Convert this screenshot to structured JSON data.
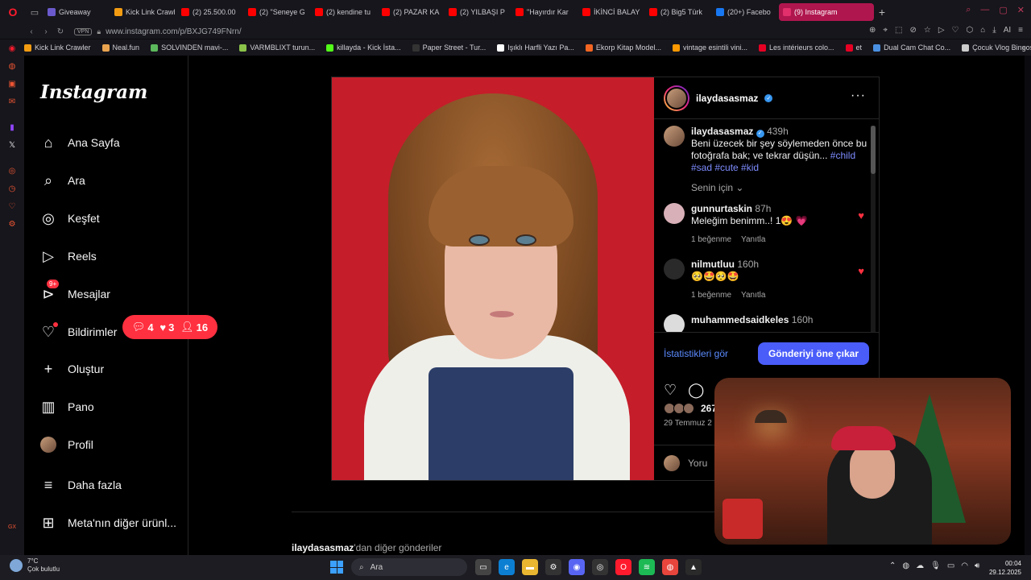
{
  "browser": {
    "tabs": [
      {
        "label": "Giveaway",
        "color": "#6a5acd"
      },
      {
        "label": "Kick Link Crawl",
        "color": "#f39c12"
      },
      {
        "label": "(2) 25.500.00",
        "color": "#ff0000"
      },
      {
        "label": "(2) \"Seneye G",
        "color": "#ff0000"
      },
      {
        "label": "(2) kendine tu",
        "color": "#ff0000"
      },
      {
        "label": "(2) PAZAR KA",
        "color": "#ff0000"
      },
      {
        "label": "(2) YILBAŞI P",
        "color": "#ff0000"
      },
      {
        "label": "\"Hayırdır Kar",
        "color": "#ff0000"
      },
      {
        "label": "İKİNCİ BALAY",
        "color": "#ff0000"
      },
      {
        "label": "(2) Big5 Türk",
        "color": "#ff0000"
      },
      {
        "label": "(20+) Facebo",
        "color": "#1877f2"
      },
      {
        "label": "(9) Instagram",
        "color": "#e1306c"
      }
    ],
    "active_tab": "(9) Instagram",
    "new_tab": "+",
    "vpn": "VPN",
    "url": "www.instagram.com/p/BXJG749FNrn/",
    "ai_label": "AI",
    "bookmarks": [
      {
        "label": "Kick Link Crawler",
        "color": "#f39c12"
      },
      {
        "label": "Neal.fun",
        "color": "#e9a34f"
      },
      {
        "label": "SOLVINDEN mavi-...",
        "color": "#5cb85c"
      },
      {
        "label": "VARMBLIXT turun...",
        "color": "#8bc34a"
      },
      {
        "label": "killayda - Kick İsta...",
        "color": "#53fc18"
      },
      {
        "label": "Paper Street - Tur...",
        "color": "#333"
      },
      {
        "label": "Işıklı Harfli Yazı Pa...",
        "color": "#fff"
      },
      {
        "label": "Ekorp Kitap Model...",
        "color": "#f26522"
      },
      {
        "label": "vintage esintili vini...",
        "color": "#ff9900"
      },
      {
        "label": "Les intérieurs colo...",
        "color": "#e60023"
      },
      {
        "label": "et",
        "color": "#e60023"
      },
      {
        "label": "Dual Cam Chat Co...",
        "color": "#4a90e2"
      },
      {
        "label": "Çocuk Vlog Bingosu",
        "color": "#ccc"
      }
    ]
  },
  "instagram": {
    "logo": "Instagram",
    "nav": [
      {
        "label": "Ana Sayfa",
        "icon": "home-icon"
      },
      {
        "label": "Ara",
        "icon": "search-icon"
      },
      {
        "label": "Keşfet",
        "icon": "compass-icon"
      },
      {
        "label": "Reels",
        "icon": "reels-icon"
      },
      {
        "label": "Mesajlar",
        "icon": "messenger-icon",
        "badge": "9+"
      },
      {
        "label": "Bildirimler",
        "icon": "heart-icon"
      },
      {
        "label": "Oluştur",
        "icon": "plus-icon"
      },
      {
        "label": "Pano",
        "icon": "dashboard-icon"
      },
      {
        "label": "Profil",
        "icon": "avatar"
      },
      {
        "label": "Daha fazla",
        "icon": "menu-icon"
      },
      {
        "label": "Meta'nın diğer ürünl...",
        "icon": "meta-apps-icon"
      }
    ],
    "notifications": {
      "comments": "4",
      "likes": "3",
      "followers": "16"
    },
    "post": {
      "username": "ilaydasasmaz",
      "caption_time": "439h",
      "caption": "Beni üzecek bir şey söylemeden önce bu fotoğrafa bak; ve tekrar düşün...",
      "caption_tag1": "#child",
      "caption_tags2": "#sad #cute #kid",
      "for_you": "Senin için",
      "comments": [
        {
          "user": "gunnurtaskin",
          "time": "87h",
          "text": "Meleğim benimm..! 1😍 💗",
          "likes": "1 beğenme",
          "reply": "Yanıtla"
        },
        {
          "user": "nilmutluu",
          "time": "160h",
          "text": "🥺🤩🥺🤩",
          "likes": "1 beğenme",
          "reply": "Yanıtla"
        },
        {
          "user": "muhammedsaidkeles",
          "time": "160h",
          "text": "",
          "likes": "",
          "reply": ""
        }
      ],
      "stats_link": "İstatistikleri gör",
      "boost_button": "Gönderiyi öne çıkar",
      "likes_count": "267",
      "date": "29 Temmuz 2",
      "comment_placeholder": "Yoru"
    },
    "more_posts_user": "ilaydasasmaz",
    "more_posts_suffix": "'dan diğer gönderiler"
  },
  "taskbar": {
    "temp": "7°C",
    "weather": "Çok bulutlu",
    "search": "Ara",
    "time": "00:04",
    "date": "29.12.2025"
  }
}
